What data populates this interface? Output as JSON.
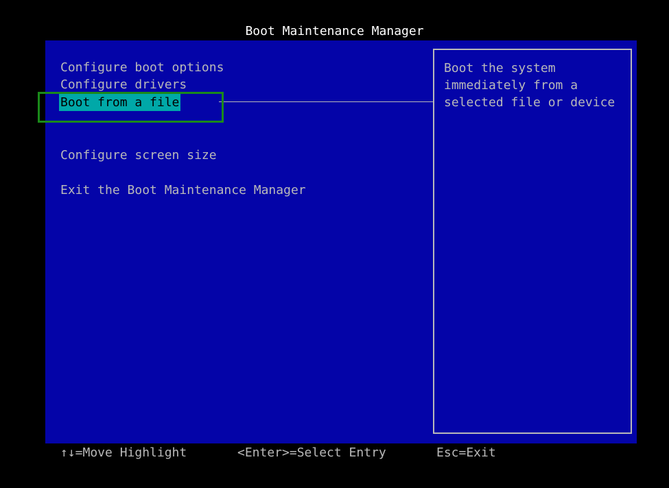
{
  "title": "Boot Maintenance Manager",
  "menu": {
    "items": [
      {
        "label": "Configure boot options"
      },
      {
        "label": "Configure drivers"
      },
      {
        "label": "Boot from a file"
      },
      {
        "label": "Configure screen size"
      },
      {
        "label": "Exit the Boot Maintenance Manager"
      }
    ],
    "selected_index": 2
  },
  "help": {
    "text": "Boot the system\nimmediately from a\nselected file or device"
  },
  "footer": {
    "move": "↑↓=Move Highlight",
    "select": "<Enter>=Select Entry",
    "exit": "Esc=Exit"
  },
  "colors": {
    "background": "#000000",
    "screen": "#0404a8",
    "text": "#b9b9b9",
    "title": "#ffffff",
    "highlight": "#00a8a8",
    "focus_outline": "#1a8a1a"
  }
}
